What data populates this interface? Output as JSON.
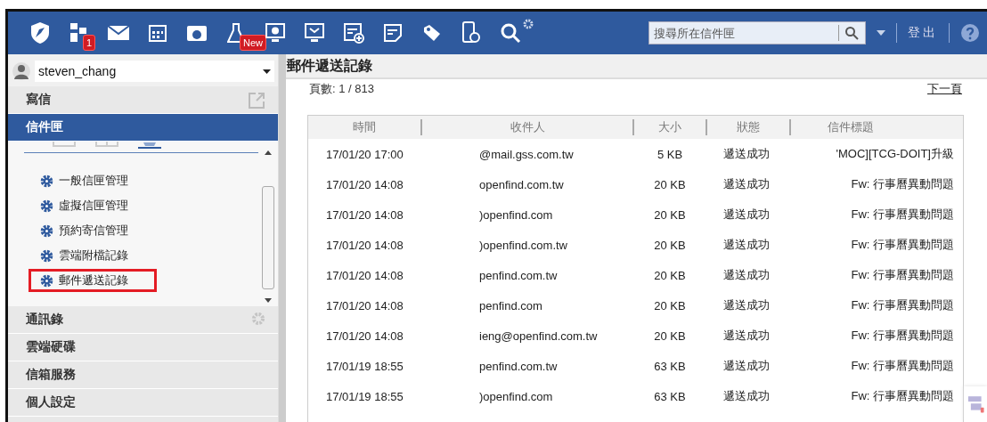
{
  "toolbar": {
    "badges": [
      {
        "text": "1"
      },
      {
        "text": "New"
      }
    ],
    "search": {
      "placeholder": "搜尋所在信件匣"
    },
    "logout": "登出"
  },
  "account": {
    "user": "steven_chang"
  },
  "sidebar": {
    "sections": [
      {
        "label": "寫信",
        "selected": false,
        "kind": "compose"
      },
      {
        "label": "信件匣",
        "selected": true,
        "kind": "folders",
        "items": [
          {
            "label": "一般信匣管理",
            "highlighted": false
          },
          {
            "label": "虛擬信匣管理",
            "highlighted": false
          },
          {
            "label": "預約寄信管理",
            "highlighted": false
          },
          {
            "label": "雲端附檔記錄",
            "highlighted": false
          },
          {
            "label": "郵件遞送記錄",
            "highlighted": true
          }
        ]
      },
      {
        "label": "通訊錄",
        "selected": false,
        "kind": "contacts"
      },
      {
        "label": "雲端硬碟",
        "selected": false,
        "kind": "plain"
      },
      {
        "label": "信箱服務",
        "selected": false,
        "kind": "plain"
      },
      {
        "label": "個人設定",
        "selected": false,
        "kind": "plain"
      }
    ]
  },
  "page": {
    "title": "郵件遞送記錄",
    "page_count": "頁數: 1 / 813",
    "next_page": "下一頁"
  },
  "table": {
    "columns": [
      "時間",
      "收件人",
      "大小",
      "狀態",
      "信件標題"
    ],
    "rows": [
      {
        "time": "17/01/20 17:00",
        "recipient": "@mail.gss.com.tw",
        "size": "5 KB",
        "status": "遞送成功",
        "subject": "'MOC][TCG-DOIT]升級"
      },
      {
        "time": "17/01/20 14:08",
        "recipient": "openfind.com.tw",
        "size": "20 KB",
        "status": "遞送成功",
        "subject": "Fw: 行事曆異動問題"
      },
      {
        "time": "17/01/20 14:08",
        "recipient": ")openfind.com",
        "size": "20 KB",
        "status": "遞送成功",
        "subject": "Fw: 行事曆異動問題"
      },
      {
        "time": "17/01/20 14:08",
        "recipient": ")openfind.com.tw",
        "size": "20 KB",
        "status": "遞送成功",
        "subject": "Fw: 行事曆異動問題"
      },
      {
        "time": "17/01/20 14:08",
        "recipient": "penfind.com.tw",
        "size": "20 KB",
        "status": "遞送成功",
        "subject": "Fw: 行事曆異動問題"
      },
      {
        "time": "17/01/20 14:08",
        "recipient": "penfind.com",
        "size": "20 KB",
        "status": "遞送成功",
        "subject": "Fw: 行事曆異動問題"
      },
      {
        "time": "17/01/20 14:08",
        "recipient": "ieng@openfind.com.tw",
        "size": "20 KB",
        "status": "遞送成功",
        "subject": "Fw: 行事曆異動問題"
      },
      {
        "time": "17/01/19 18:55",
        "recipient": "penfind.com.tw",
        "size": "63 KB",
        "status": "遞送成功",
        "subject": "Fw: 行事曆異動問題"
      },
      {
        "time": "17/01/19 18:55",
        "recipient": ")openfind.com",
        "size": "63 KB",
        "status": "遞送成功",
        "subject": "Fw: 行事曆異動問題"
      }
    ]
  }
}
